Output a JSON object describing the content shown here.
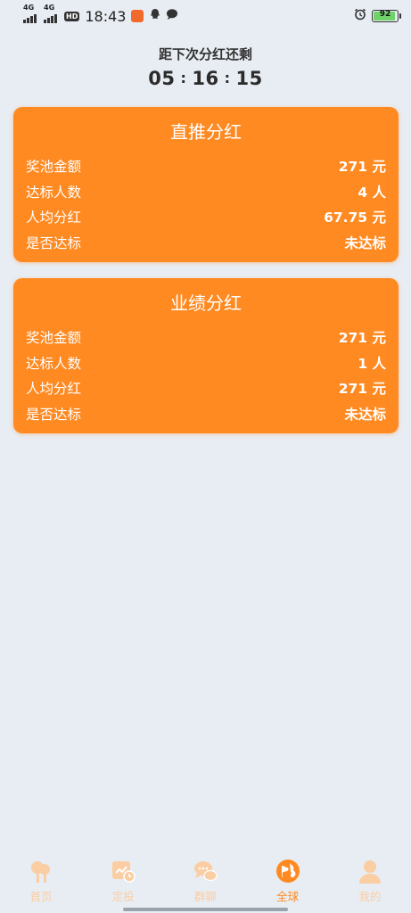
{
  "status_bar": {
    "time": "18:43",
    "network_1": "4G",
    "network_2": "4G",
    "hd_label": "HD",
    "battery": "92",
    "battery_level": 0.92
  },
  "countdown": {
    "title": "距下次分红还剩",
    "hours": "05",
    "minutes": "16",
    "seconds": "15",
    "separator": ":"
  },
  "cards": [
    {
      "title": "直推分红",
      "rows": [
        {
          "label": "奖池金额",
          "value": "271 元"
        },
        {
          "label": "达标人数",
          "value": "4 人"
        },
        {
          "label": "人均分红",
          "value": "67.75 元"
        },
        {
          "label": "是否达标",
          "value": "未达标"
        }
      ]
    },
    {
      "title": "业绩分红",
      "rows": [
        {
          "label": "奖池金额",
          "value": "271 元"
        },
        {
          "label": "达标人数",
          "value": "1 人"
        },
        {
          "label": "人均分红",
          "value": "271 元"
        },
        {
          "label": "是否达标",
          "value": "未达标"
        }
      ]
    }
  ],
  "tabs": [
    {
      "label": "首页",
      "icon": "tree-icon"
    },
    {
      "label": "定投",
      "icon": "chart-clock-icon"
    },
    {
      "label": "群聊",
      "icon": "chat-bubbles-icon"
    },
    {
      "label": "全球",
      "icon": "globe-icon",
      "active": true
    },
    {
      "label": "我的",
      "icon": "person-icon"
    }
  ],
  "colors": {
    "accent": "#ff8a22",
    "tab_inactive": "#fbcda3",
    "background": "#e8edf3"
  }
}
